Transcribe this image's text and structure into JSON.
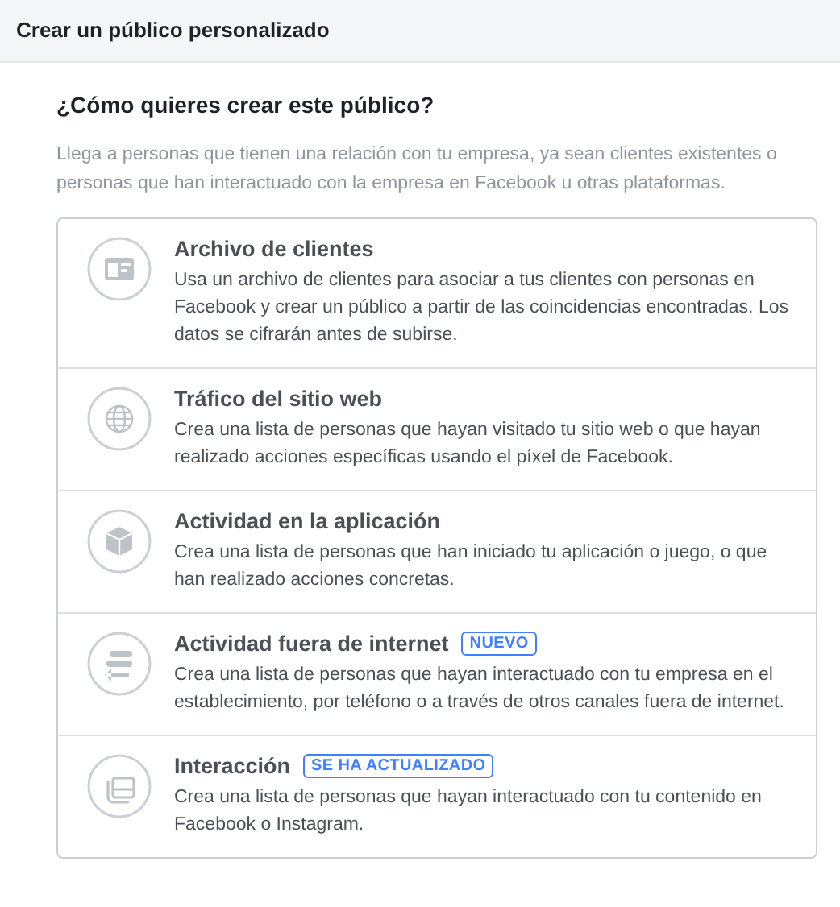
{
  "header": {
    "title": "Crear un público personalizado"
  },
  "question": "¿Cómo quieres crear este público?",
  "description": "Llega a personas que tienen una relación con tu empresa, ya sean clientes existentes o personas que han interactuado con la empresa en Facebook u otras plataformas.",
  "options": [
    {
      "kind": "card",
      "title": "Archivo de clientes",
      "text": "Usa un archivo de clientes para asociar a tus clientes con personas en Facebook y crear un público a partir de las coincidencias encontradas. Los datos se cifrarán antes de subirse."
    },
    {
      "kind": "globe",
      "title": "Tráfico del sitio web",
      "text": "Crea una lista de personas que hayan visitado tu sitio web o que hayan realizado acciones específicas usando el píxel de Facebook."
    },
    {
      "kind": "cube",
      "title": "Actividad en la aplicación",
      "text": "Crea una lista de personas que han iniciado tu aplicación o juego, o que han realizado acciones concretas."
    },
    {
      "kind": "arrows",
      "title": "Actividad fuera de internet",
      "badge": "NUEVO",
      "text": "Crea una lista de personas que hayan interactuado con tu empresa en el establecimiento, por teléfono o a través de otros canales fuera de internet."
    },
    {
      "kind": "stack",
      "title": "Interacción",
      "badge": "SE HA ACTUALIZADO",
      "text": "Crea una lista de personas que hayan interactuado con tu contenido en Facebook o Instagram."
    }
  ]
}
